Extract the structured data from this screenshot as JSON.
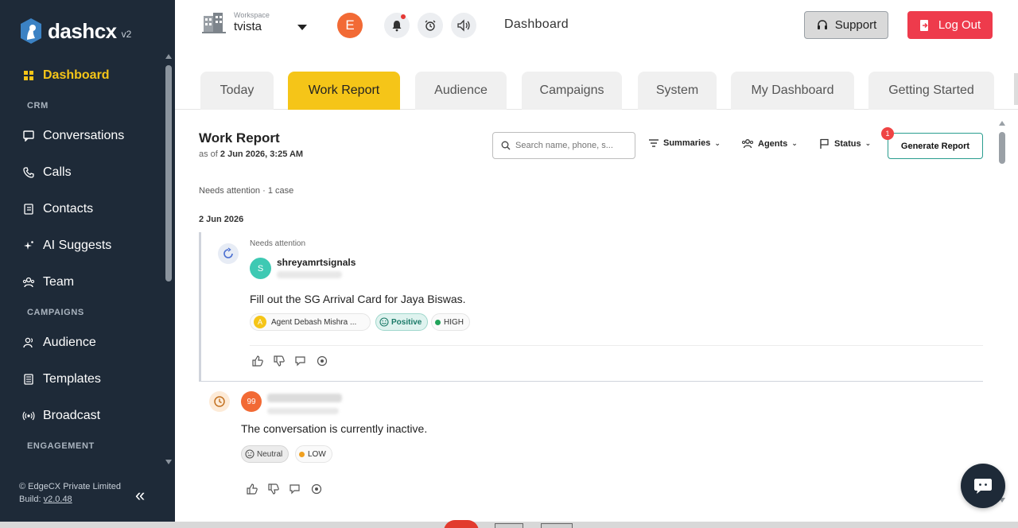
{
  "sidebar": {
    "logo_text_a": "dash",
    "logo_text_b": "cx",
    "logo_version": "v2",
    "items": [
      {
        "label": "Dashboard",
        "icon": "grid-icon",
        "active": true
      },
      {
        "section": "CRM"
      },
      {
        "label": "Conversations",
        "icon": "chat-icon"
      },
      {
        "label": "Calls",
        "icon": "phone-icon"
      },
      {
        "label": "Contacts",
        "icon": "contacts-icon"
      },
      {
        "label": "AI Suggests",
        "icon": "sparkle-icon"
      },
      {
        "label": "Team",
        "icon": "team-icon"
      },
      {
        "section": "CAMPAIGNS"
      },
      {
        "label": "Audience",
        "icon": "audience-icon"
      },
      {
        "label": "Templates",
        "icon": "template-icon"
      },
      {
        "label": "Broadcast",
        "icon": "broadcast-icon"
      },
      {
        "section": "ENGAGEMENT"
      }
    ],
    "footer_company": "© EdgeCX Private Limited",
    "footer_build_label": "Build:",
    "footer_build_version": "v2.0.48",
    "collapse_glyph": "«"
  },
  "topbar": {
    "workspace_label": "Workspace",
    "workspace_name": "tvista",
    "user_initial": "E",
    "title": "Dashboard",
    "support_label": "Support",
    "logout_label": "Log Out"
  },
  "tabs": [
    {
      "label": "Today"
    },
    {
      "label": "Work Report",
      "active": true
    },
    {
      "label": "Audience"
    },
    {
      "label": "Campaigns"
    },
    {
      "label": "System"
    },
    {
      "label": "My Dashboard"
    },
    {
      "label": "Getting Started"
    }
  ],
  "report": {
    "title": "Work Report",
    "as_of_prefix": "as of",
    "as_of_value": "2 Jun 2026, 3:25 AM",
    "search_placeholder": "Search name, phone, s...",
    "filters": {
      "summaries": "Summaries",
      "agents": "Agents",
      "status": "Status"
    },
    "generate_label": "Generate Report",
    "generate_badge": "1",
    "summary_line": "Needs attention · 1 case",
    "date_heading": "2 Jun 2026"
  },
  "cases": [
    {
      "status_label": "Needs attention",
      "avatar_initial": "S",
      "customer_name": "shreyamrtsignals",
      "text": "Fill out the SG Arrival Card for Jaya Biswas.",
      "agent_initial": "A",
      "agent": "Agent Debash Mishra ...",
      "sentiment": "Positive",
      "priority": "HIGH"
    },
    {
      "avatar_initial": "99",
      "text": "The conversation is currently inactive.",
      "sentiment": "Neutral",
      "priority": "LOW"
    }
  ],
  "colors": {
    "sidebar_bg": "#1e2a38",
    "accent": "#f5c518",
    "logout": "#ee3b4c",
    "high": "#22a35a",
    "low": "#f0a020"
  }
}
